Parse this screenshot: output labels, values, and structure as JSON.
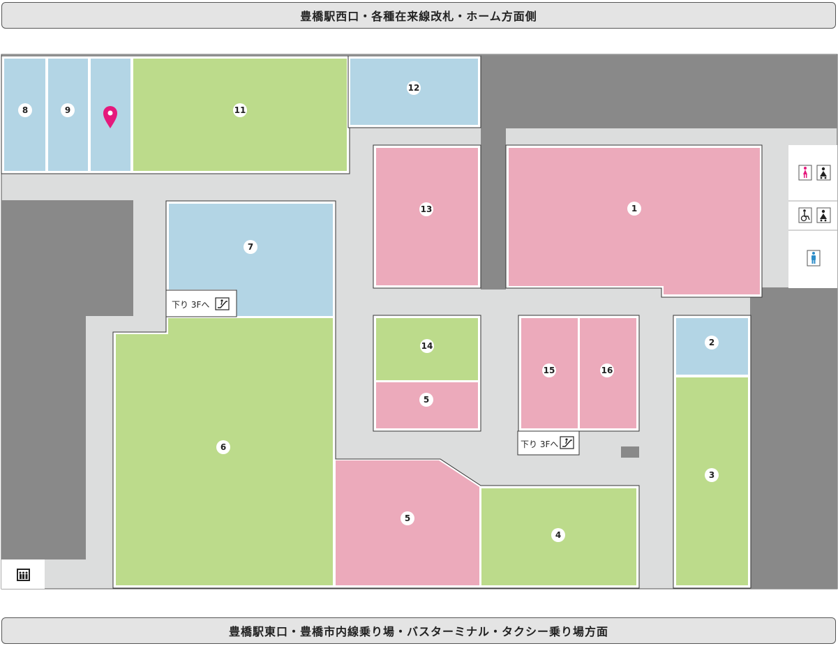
{
  "banners": {
    "top": "豊橋駅西口・各種在来線改札・ホーム方面側",
    "bottom": "豊橋駅東口・豊橋市内線乗り場・バスターミナル・タクシー乗り場方面"
  },
  "colors": {
    "corridor": "#dcdddd",
    "blocked": "#898989",
    "blue": "#b3d5e5",
    "green": "#bcdb8b",
    "pink": "#ecaabb",
    "pin": "#e5197c",
    "toilet_women": "#e5197c",
    "toilet_men": "#2e8dc8"
  },
  "shops": [
    {
      "id": "8",
      "label": "8",
      "color": "blue"
    },
    {
      "id": "9",
      "label": "9",
      "color": "blue"
    },
    {
      "id": "10",
      "label": "",
      "color": "blue"
    },
    {
      "id": "11",
      "label": "11",
      "color": "green"
    },
    {
      "id": "12",
      "label": "12",
      "color": "blue"
    },
    {
      "id": "13",
      "label": "13",
      "color": "pink"
    },
    {
      "id": "1",
      "label": "1",
      "color": "pink"
    },
    {
      "id": "7",
      "label": "7",
      "color": "blue"
    },
    {
      "id": "6",
      "label": "6",
      "color": "green"
    },
    {
      "id": "14",
      "label": "14",
      "color": "green"
    },
    {
      "id": "5a",
      "label": "5",
      "color": "pink"
    },
    {
      "id": "15",
      "label": "15",
      "color": "pink"
    },
    {
      "id": "16",
      "label": "16",
      "color": "pink"
    },
    {
      "id": "2",
      "label": "2",
      "color": "blue"
    },
    {
      "id": "3",
      "label": "3",
      "color": "green"
    },
    {
      "id": "5b",
      "label": "5",
      "color": "pink"
    },
    {
      "id": "4",
      "label": "4",
      "color": "green"
    }
  ],
  "escalator_notes": [
    {
      "id": "esc-1",
      "text": "下り 3Fへ",
      "icon": "escalator-icon"
    },
    {
      "id": "esc-2",
      "text": "下り 3Fへ",
      "icon": "escalator-icon"
    }
  ],
  "facilities": [
    {
      "id": "womens-toilet",
      "icon": "womens-toilet-icon"
    },
    {
      "id": "baby-room-1",
      "icon": "baby-care-icon"
    },
    {
      "id": "accessible-toilet",
      "icon": "wheelchair-icon"
    },
    {
      "id": "baby-room-2",
      "icon": "baby-care-icon"
    },
    {
      "id": "mens-toilet",
      "icon": "mens-toilet-icon"
    },
    {
      "id": "elevator",
      "icon": "elevator-icon"
    }
  ],
  "location_pin": {
    "icon": "location-pin-icon",
    "shop": "10"
  }
}
